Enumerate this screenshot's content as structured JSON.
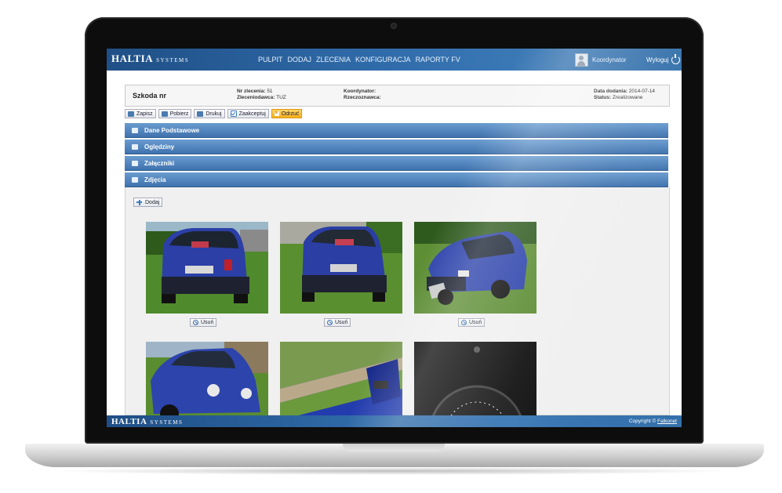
{
  "header": {
    "logo_main": "HALTIA",
    "logo_sub": "SYSTEMS",
    "nav": [
      "PULPIT",
      "DODAJ",
      "ZLECENIA",
      "KONFIGURACJA",
      "RAPORTY FV"
    ],
    "user_name": "Koordynator",
    "logout_label": "Wyloguj"
  },
  "info": {
    "title": "Szkoda nr",
    "nr_zlecenia_label": "Nr zlecenia:",
    "nr_zlecenia_value": "51",
    "zleceniodawca_label": "Zleceniodawca:",
    "zleceniodawca_value": "TUZ",
    "koordynator_label": "Koordynator:",
    "rzeczoznawca_label": "Rzeczoznawca:",
    "data_label": "Data dodania:",
    "data_value": "2014-07-14",
    "status_label": "Status:",
    "status_value": "Zrealizowane"
  },
  "toolbar": {
    "save": "Zapisz",
    "download": "Pobierz",
    "print": "Drukuj",
    "accept": "Zaakceptuj",
    "reject": "Odrzuć"
  },
  "sections": [
    "Dane Podstawowe",
    "Oględziny",
    "Załączniki",
    "Zdjęcia"
  ],
  "photos": {
    "add_label": "Dodaj",
    "delete_label": "Usuń"
  },
  "footer": {
    "logo_main": "HALTIA",
    "logo_sub": "SYSTEMS",
    "copyright": "Copyright ©",
    "company": "Falkonet"
  },
  "colors": {
    "header_blue": "#2f6aa8",
    "accordion_blue": "#4f82bd",
    "reject_orange": "#f5b01c",
    "car_blue": "#2b3fa6"
  }
}
